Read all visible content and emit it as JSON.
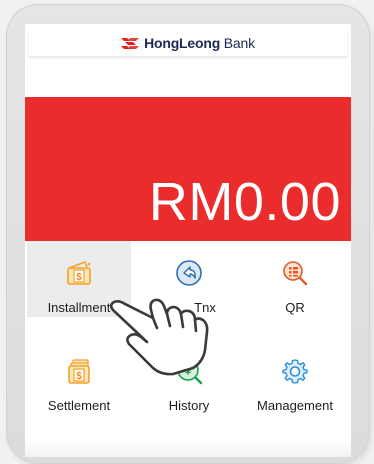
{
  "header": {
    "logo_brand": "HongLeong",
    "logo_suffix": "Bank",
    "logo_icon": "hong-leong-bank-logo-mark",
    "brand_color": "#1a2a52",
    "logo_icon_color": "#e2231a"
  },
  "balance": {
    "amount": "RM0.00",
    "banner_color": "#ea2c2c"
  },
  "menu": {
    "items": [
      {
        "label": "Installment",
        "icon": "installment-wallet-dollar-icon",
        "color": "#f2a32f",
        "selected": true
      },
      {
        "label": "Tnx",
        "icon": "refund-arrow-icon",
        "color": "#2f6fb0",
        "selected": false
      },
      {
        "label": "QR",
        "icon": "qr-search-icon",
        "color": "#e35a1f",
        "selected": false
      },
      {
        "label": "Settlement",
        "icon": "settlement-stack-dollar-icon",
        "color": "#f2a32f",
        "selected": false
      },
      {
        "label": "History",
        "icon": "history-yen-search-icon",
        "color": "#1aa14a",
        "selected": false
      },
      {
        "label": "Management",
        "icon": "management-gear-icon",
        "color": "#2b8fd6",
        "selected": false
      }
    ]
  },
  "overlay": {
    "icon": "pointing-hand-icon"
  }
}
